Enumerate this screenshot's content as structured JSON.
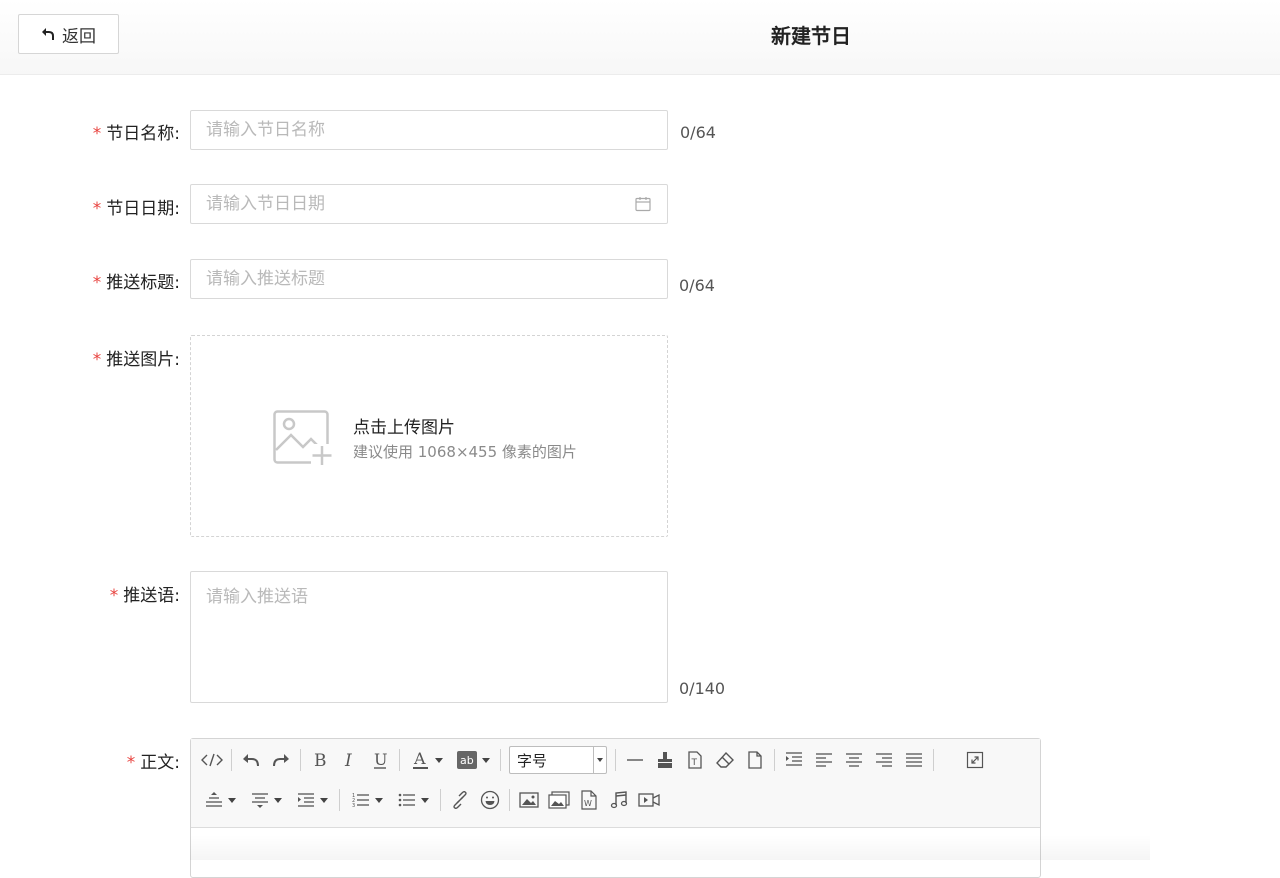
{
  "header": {
    "back_label": "返回",
    "title": "新建节日"
  },
  "form": {
    "required_mark": "*",
    "name": {
      "label": "节日名称:",
      "placeholder": "请输入节日名称",
      "counter": "0/64"
    },
    "date": {
      "label": "节日日期:",
      "placeholder": "请输入节日日期"
    },
    "push_title": {
      "label": "推送标题:",
      "placeholder": "请输入推送标题",
      "counter": "0/64"
    },
    "push_image": {
      "label": "推送图片:",
      "upload_title": "点击上传图片",
      "upload_hint": "建议使用 1068×455 像素的图片"
    },
    "push_text": {
      "label": "推送语:",
      "placeholder": "请输入推送语",
      "counter": "0/140"
    },
    "body": {
      "label": "正文:",
      "font_size_label": "字号"
    }
  },
  "toolbar_icons": {
    "row1": [
      "source-code-icon",
      "undo-icon",
      "redo-icon",
      "bold-icon",
      "italic-icon",
      "underline-icon",
      "font-color-icon",
      "background-color-icon",
      "font-size-select",
      "horizontal-rule-icon",
      "format-painter-icon",
      "text-box-icon",
      "eraser-icon",
      "new-page-icon",
      "indent-icon",
      "align-left-icon",
      "align-center-icon",
      "align-right-icon",
      "align-justify-icon",
      "fullscreen-icon"
    ],
    "row2": [
      "line-height-icon",
      "paragraph-spacing-icon",
      "indent-dropdown-icon",
      "ordered-list-icon",
      "unordered-list-icon",
      "link-icon",
      "emoji-icon",
      "image-icon",
      "multi-image-icon",
      "word-icon",
      "music-icon",
      "video-icon"
    ]
  },
  "colors": {
    "required": "#e8423e",
    "border": "#d9d9d9",
    "placeholder": "#b9b9b9"
  }
}
